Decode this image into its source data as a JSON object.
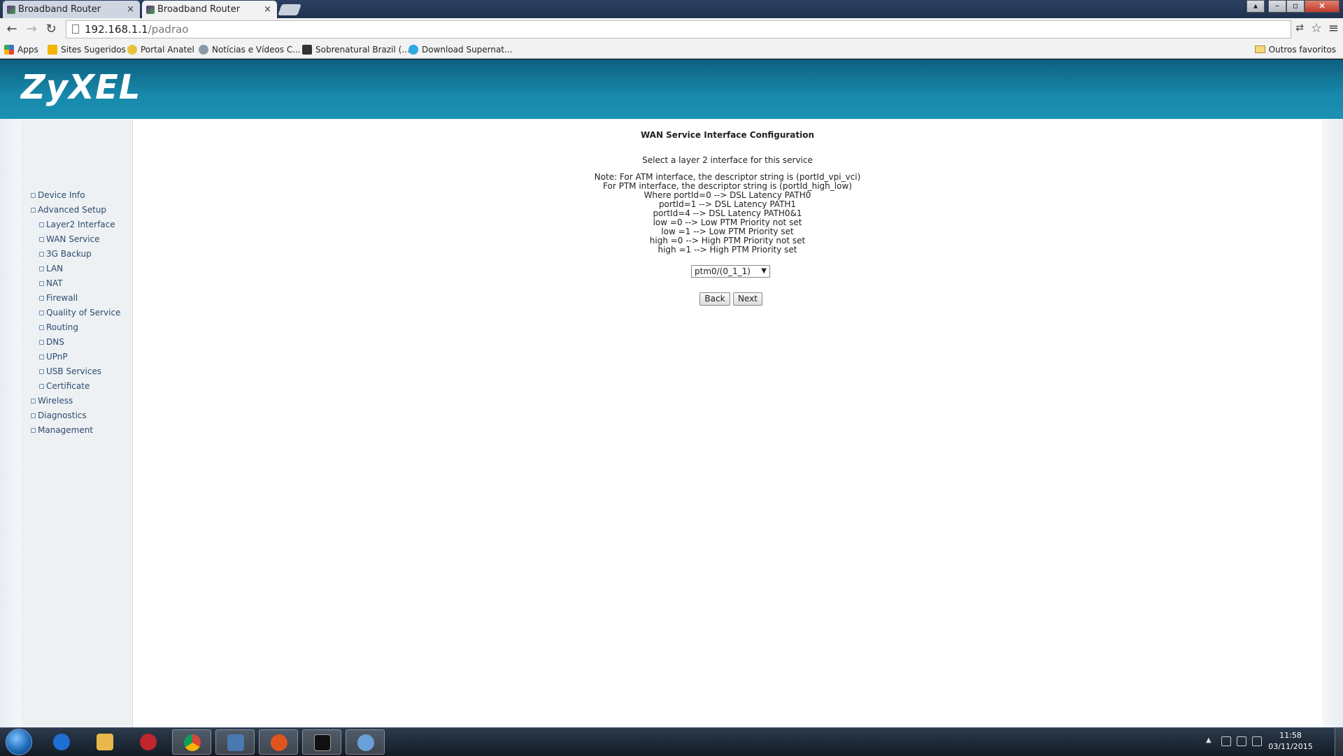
{
  "browser": {
    "tabs": [
      {
        "title": "Broadband Router"
      },
      {
        "title": "Broadband Router"
      }
    ],
    "close_glyph": "×",
    "url_host": "192.168.1.1",
    "url_path": "/padrao",
    "bookmarks": [
      {
        "label": "Apps"
      },
      {
        "label": "Sites Sugeridos"
      },
      {
        "label": "Portal Anatel"
      },
      {
        "label": "Notícias e Vídeos C..."
      },
      {
        "label": "Sobrenatural Brazil (..."
      },
      {
        "label": "Download Supernat..."
      }
    ],
    "other_bookmarks": "Outros favoritos",
    "icon_colors": [
      "#3b74d9",
      "#f4b400",
      "#e6c23a",
      "#8a9aa8",
      "#333333",
      "#2ea8e0"
    ]
  },
  "header": {
    "logo": "ZyXEL"
  },
  "sidebar": {
    "items": [
      {
        "label": "Device Info"
      },
      {
        "label": "Advanced Setup"
      },
      {
        "label": "Layer2 Interface"
      },
      {
        "label": "WAN Service"
      },
      {
        "label": "3G Backup"
      },
      {
        "label": "LAN"
      },
      {
        "label": "NAT"
      },
      {
        "label": "Firewall"
      },
      {
        "label": "Quality of Service"
      },
      {
        "label": "Routing"
      },
      {
        "label": "DNS"
      },
      {
        "label": "UPnP"
      },
      {
        "label": "USB Services"
      },
      {
        "label": "Certificate"
      },
      {
        "label": "Wireless"
      },
      {
        "label": "Diagnostics"
      },
      {
        "label": "Management"
      }
    ]
  },
  "main": {
    "title": "WAN Service Interface Configuration",
    "instruction": "Select a layer 2 interface for this service",
    "notes": [
      "Note: For ATM interface, the descriptor string is (portId_vpi_vci)",
      "For PTM interface, the descriptor string is (portId_high_low)",
      "Where portId=0 --> DSL Latency PATH0",
      "portId=1 --> DSL Latency PATH1",
      "portId=4 --> DSL Latency PATH0&1",
      "low =0 --> Low PTM Priority not set",
      "low =1 --> Low PTM Priority set",
      "high =0 --> High PTM Priority not set",
      "high =1 --> High PTM Priority set"
    ],
    "interface_selected": "ptm0/(0_1_1)",
    "back_label": "Back",
    "next_label": "Next"
  },
  "taskbar": {
    "time": "11:58",
    "date": "03/11/2015",
    "app_colors": [
      "#1e6fd1",
      "#e8b84a",
      "#c0262c",
      "#3aa757",
      "#4a78b0",
      "#e0541e",
      "#111111",
      "#6a9fd8"
    ]
  },
  "colors": {
    "header_blue": "#1889ab",
    "nav_text": "#2b4a6f"
  }
}
